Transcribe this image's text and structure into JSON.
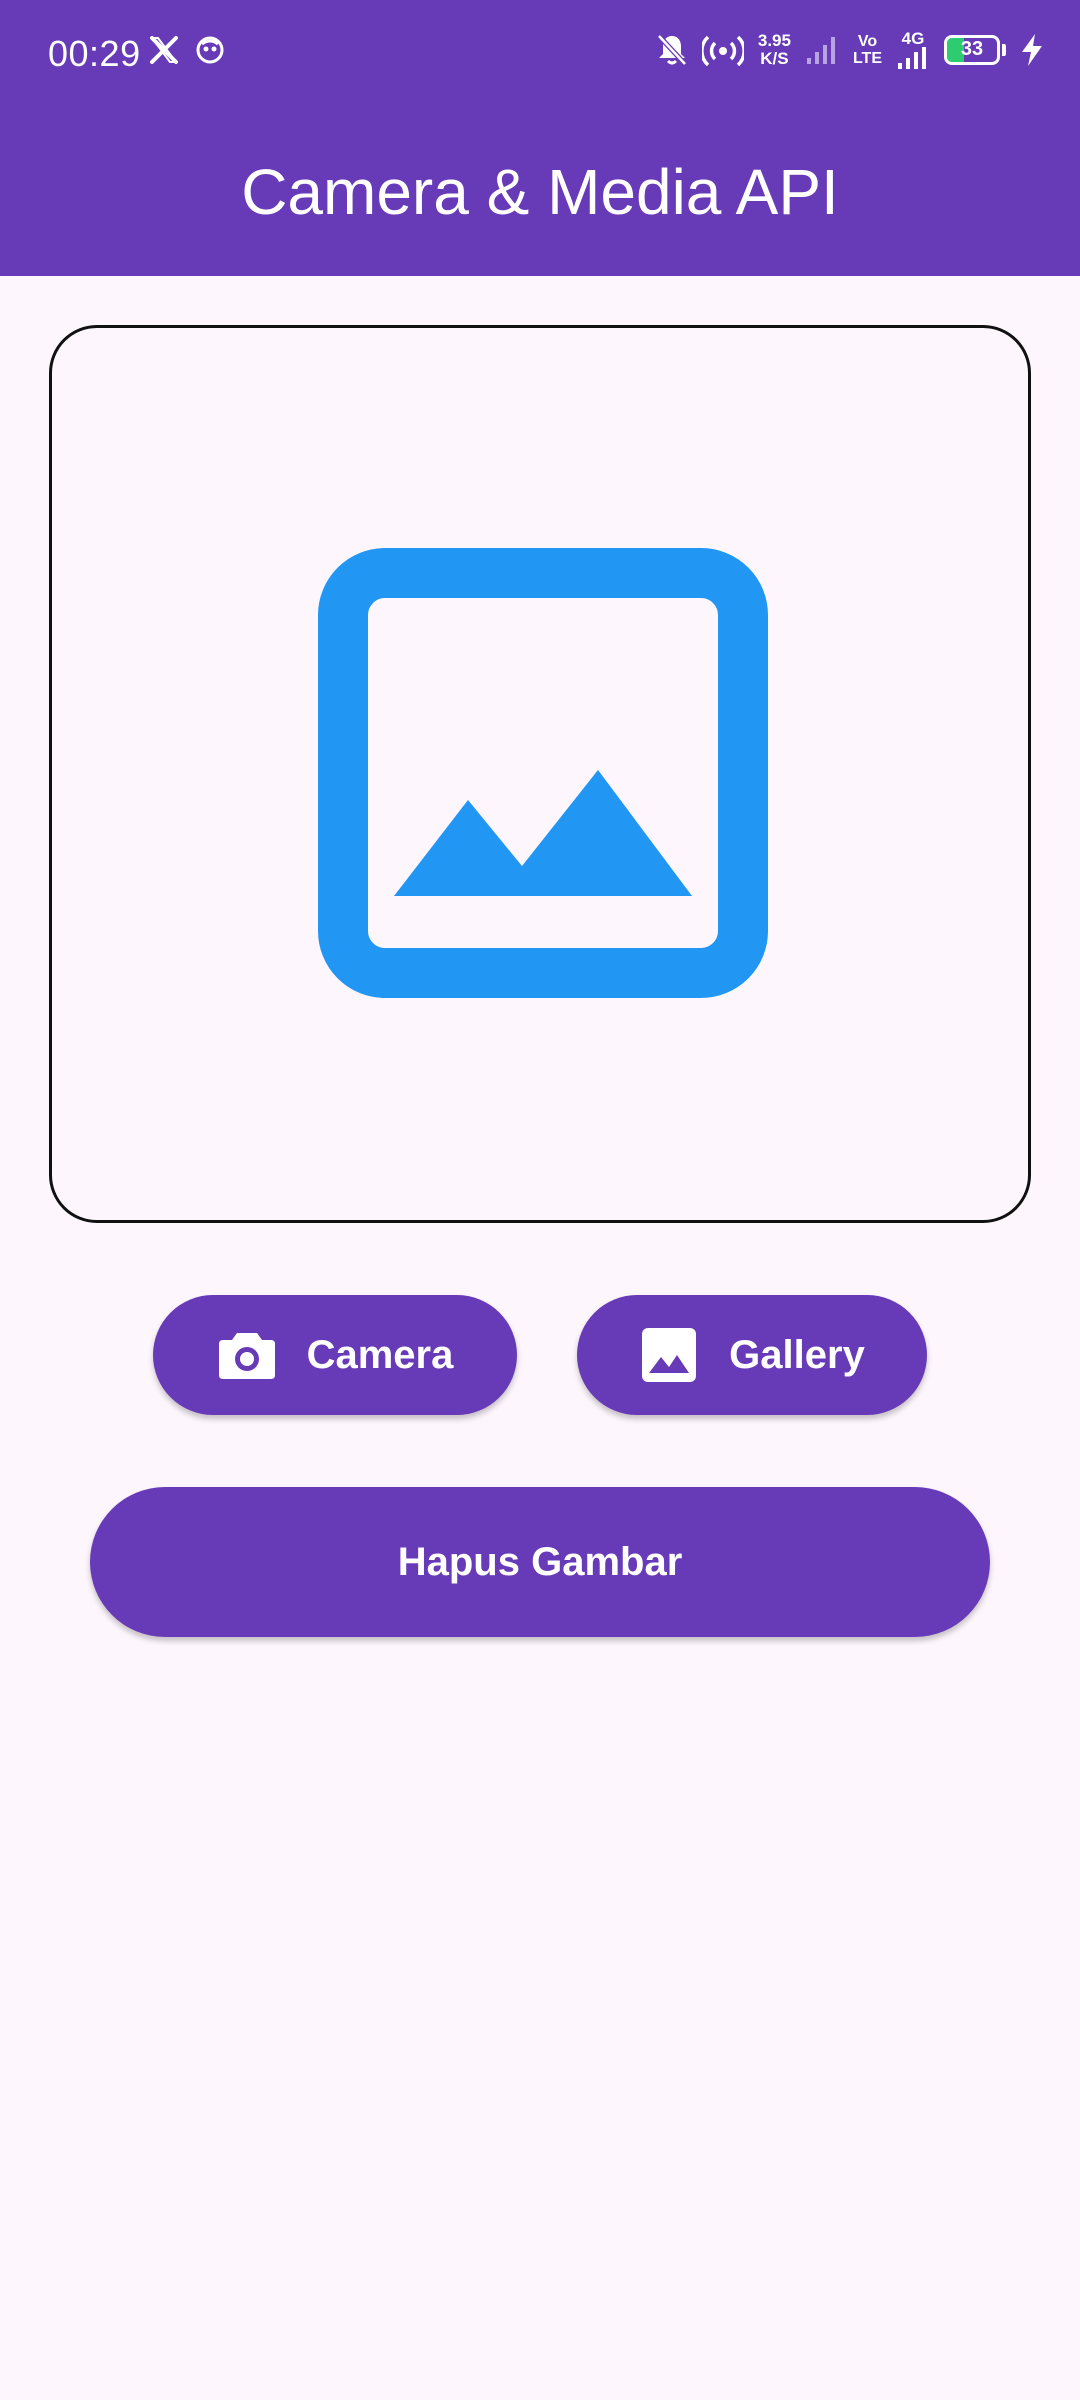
{
  "status_bar": {
    "time": "00:29",
    "net_speed_value": "3.95",
    "net_speed_unit": "K/S",
    "volte_top": "Vo",
    "volte_bottom": "LTE",
    "network_type": "4G",
    "battery_level": "33",
    "battery_fraction": 0.33,
    "icons": [
      "x-logo-icon",
      "notification-app-icon",
      "bell-off-icon",
      "hotspot-icon",
      "signal-weak-icon",
      "signal-strong-icon",
      "charging-bolt-icon"
    ]
  },
  "app_bar": {
    "title": "Camera & Media API"
  },
  "image_preview": {
    "placeholder_icon": "image-placeholder-icon",
    "icon_color": "#2196f3"
  },
  "buttons": {
    "camera_label": "Camera",
    "camera_icon": "camera-icon",
    "gallery_label": "Gallery",
    "gallery_icon": "gallery-icon",
    "clear_label": "Hapus Gambar"
  },
  "colors": {
    "primary": "#673ab7",
    "background": "#fdf6fd",
    "on_primary": "#ffffff",
    "battery": "#2ecc71"
  }
}
